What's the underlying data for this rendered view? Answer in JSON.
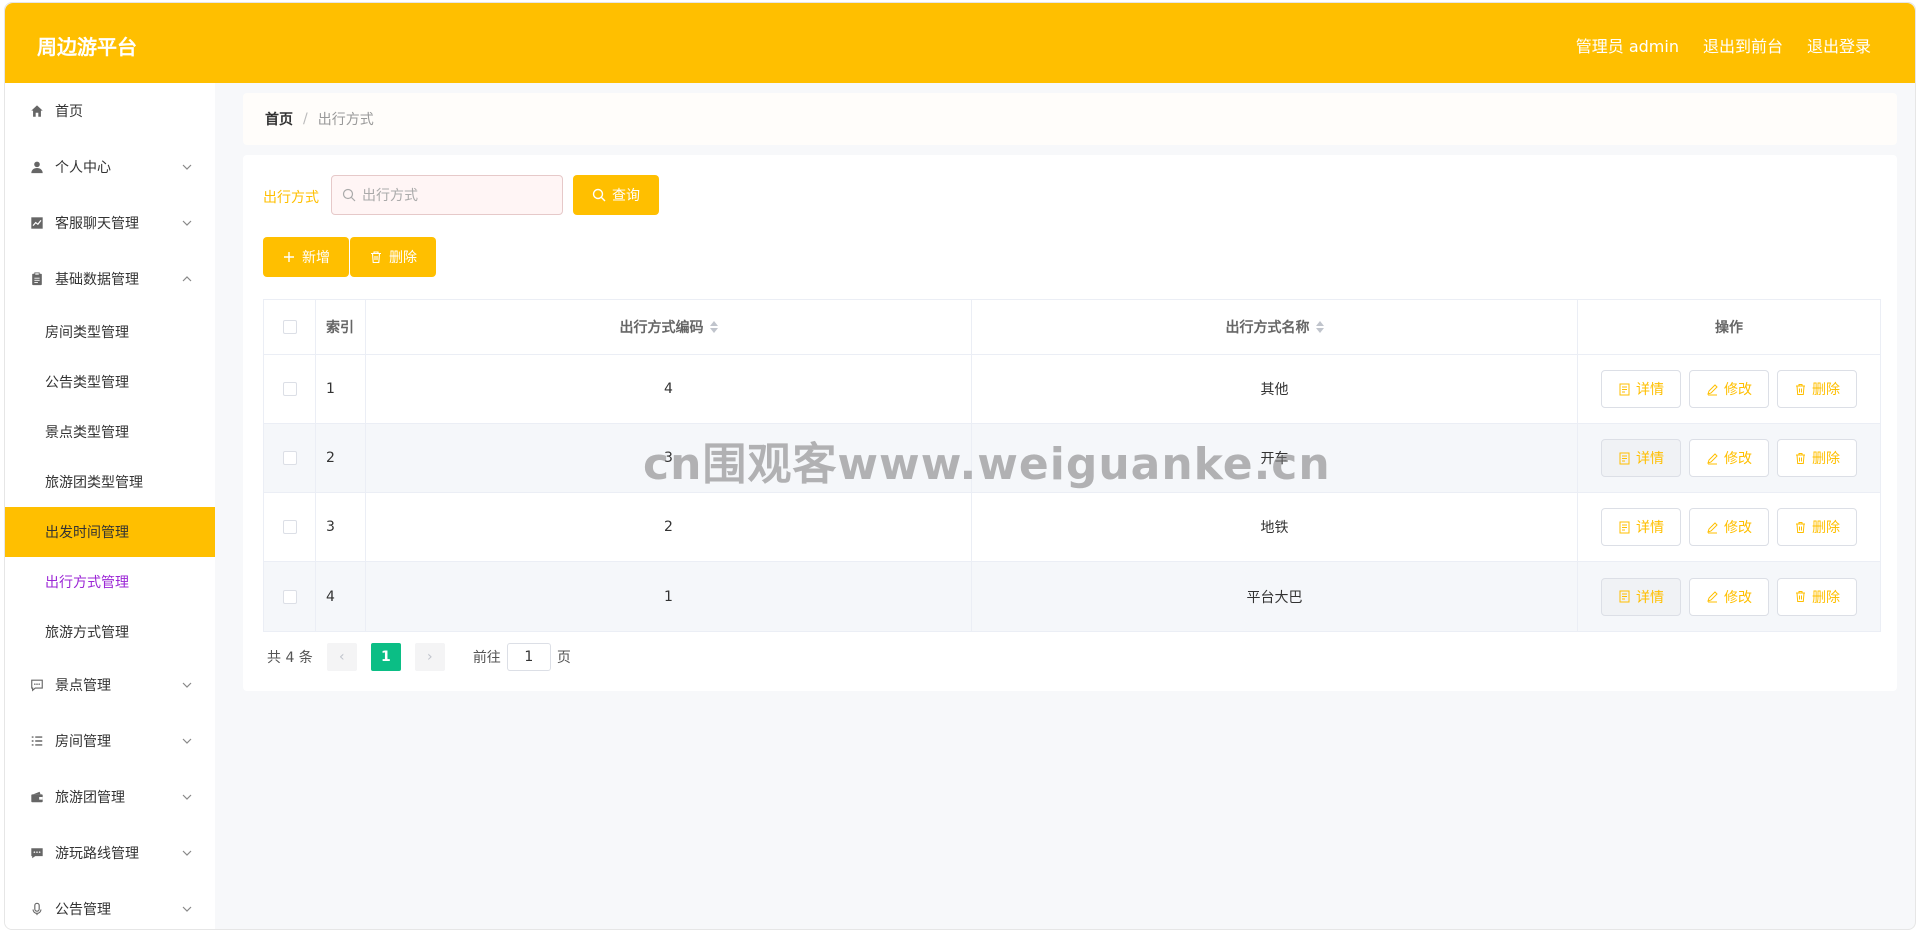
{
  "header": {
    "brand": "周边游平台",
    "admin_label": "管理员 admin",
    "to_front": "退出到前台",
    "logout": "退出登录"
  },
  "sidebar": {
    "items": [
      {
        "label": "首页",
        "icon": "home-icon"
      },
      {
        "label": "个人中心",
        "icon": "user-icon"
      },
      {
        "label": "客服聊天管理",
        "icon": "chart-icon"
      },
      {
        "label": "基础数据管理",
        "icon": "clipboard-icon"
      }
    ],
    "sub_items": [
      {
        "label": "房间类型管理"
      },
      {
        "label": "公告类型管理"
      },
      {
        "label": "景点类型管理"
      },
      {
        "label": "旅游团类型管理"
      },
      {
        "label": "出发时间管理"
      },
      {
        "label": "出行方式管理"
      },
      {
        "label": "旅游方式管理"
      }
    ],
    "items_after": [
      {
        "label": "景点管理",
        "icon": "chat-icon"
      },
      {
        "label": "房间管理",
        "icon": "list-icon"
      },
      {
        "label": "旅游团管理",
        "icon": "wallet-icon"
      },
      {
        "label": "游玩路线管理",
        "icon": "message-icon"
      },
      {
        "label": "公告管理",
        "icon": "mic-icon"
      }
    ]
  },
  "breadcrumb": {
    "home": "首页",
    "separator": "/",
    "current": "出行方式"
  },
  "search": {
    "label": "出行方式",
    "placeholder": "出行方式",
    "button": "查询"
  },
  "toolbar": {
    "add": "新增",
    "delete": "删除"
  },
  "table": {
    "headers": {
      "index": "索引",
      "code": "出行方式编码",
      "name": "出行方式名称",
      "ops": "操作"
    },
    "rows": [
      {
        "index": "1",
        "code": "4",
        "name": "其他"
      },
      {
        "index": "2",
        "code": "3",
        "name": "开车"
      },
      {
        "index": "3",
        "code": "2",
        "name": "地铁"
      },
      {
        "index": "4",
        "code": "1",
        "name": "平台大巴"
      }
    ],
    "ops": {
      "detail": "详情",
      "edit": "修改",
      "delete": "删除"
    }
  },
  "pagination": {
    "total": "共 4 条",
    "current": "1",
    "goto_prefix": "前往",
    "goto_value": "1",
    "goto_suffix": "页"
  },
  "watermark": "cn围观客www.weiguanke.cn",
  "colors": {
    "accent": "#ffbf00",
    "active_text": "#9b26d6",
    "page_current": "#0bbe85"
  }
}
